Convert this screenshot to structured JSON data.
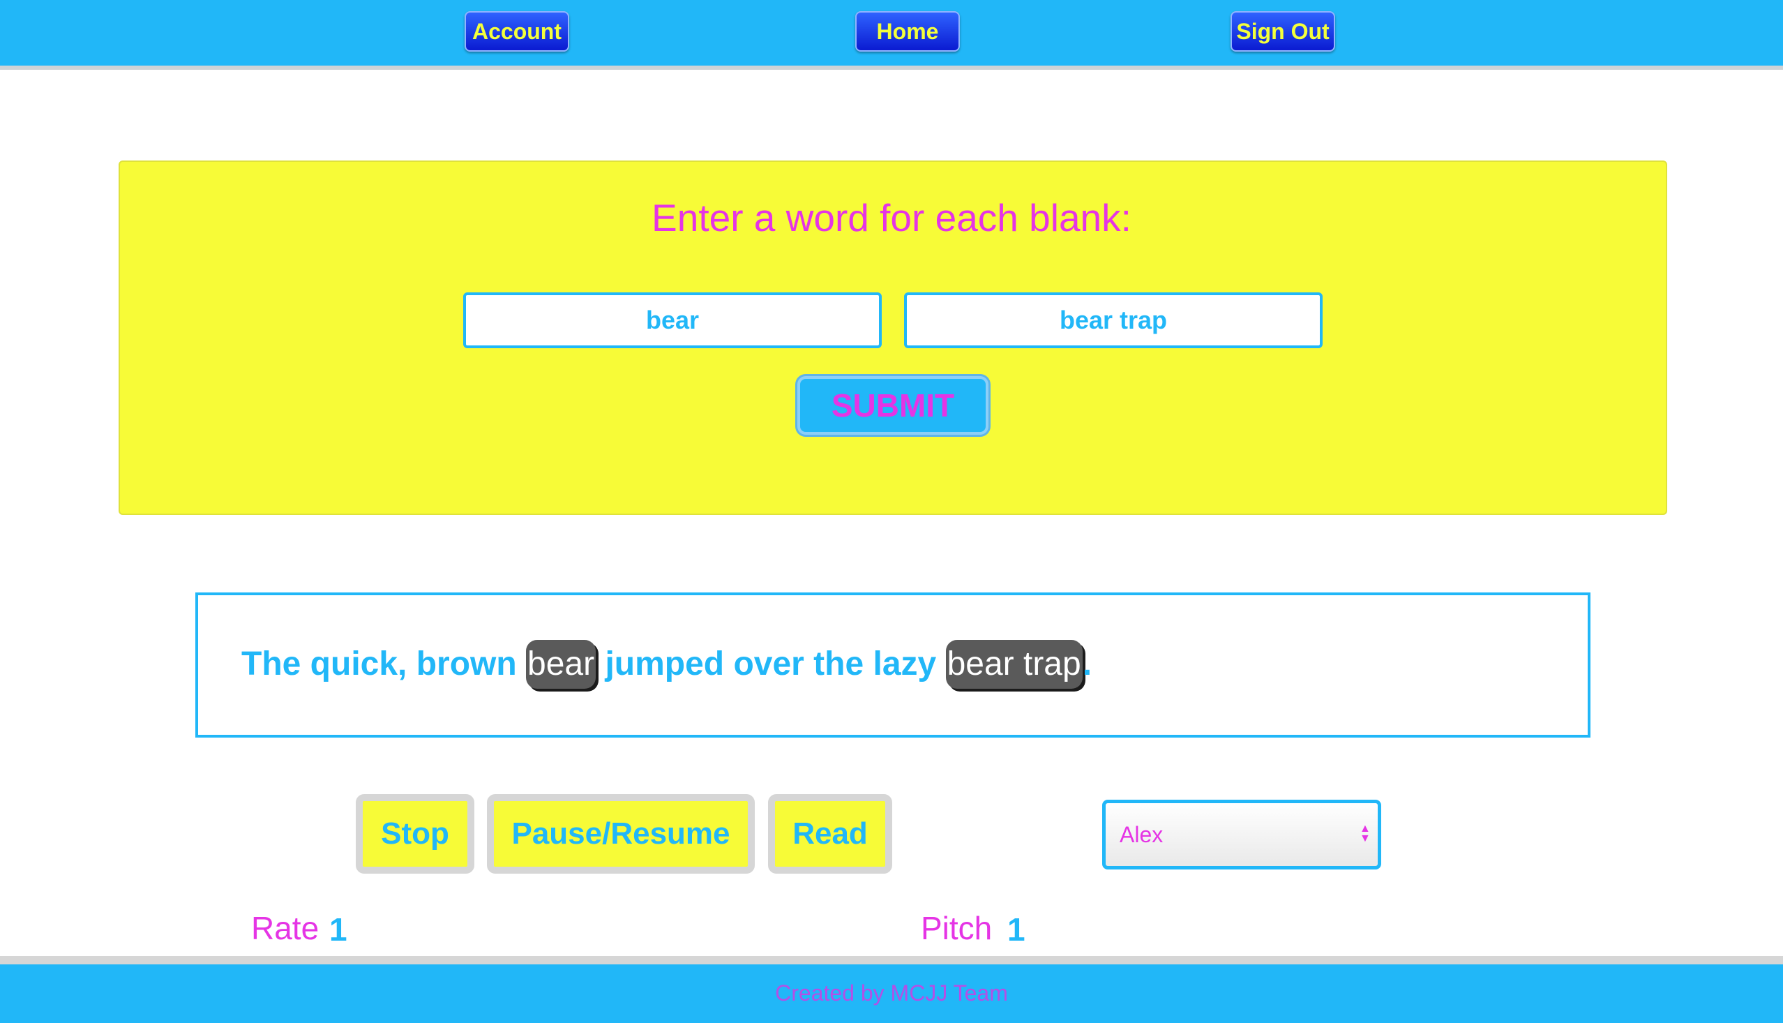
{
  "nav": {
    "account_label": "Account",
    "home_label": "Home",
    "signout_label": "Sign Out"
  },
  "form": {
    "title": "Enter a word for each blank:",
    "inputs": [
      "bear",
      "bear trap"
    ],
    "submit_label": "SUBMIT"
  },
  "story": {
    "segments": [
      "The quick, brown ",
      "bear",
      " jumped over the lazy ",
      "bear trap",
      "."
    ]
  },
  "controls": {
    "stop_label": "Stop",
    "pause_label": "Pause/Resume",
    "read_label": "Read",
    "voice_selected": "Alex"
  },
  "params": {
    "rate_label": "Rate",
    "rate_value": "1",
    "pitch_label": "Pitch",
    "pitch_value": "1"
  },
  "footer": {
    "text": "Created by MCJJ Team"
  },
  "colors": {
    "nav_bg": "#21b7f8",
    "card_bg": "#f7fb37",
    "accent_magenta": "#e534e5",
    "accent_blue": "#21b7f8",
    "nav_button": "#0b1bd1",
    "blank_fill": "#5a5a5a"
  },
  "icons": {
    "select_arrows": "updown-arrows-icon"
  }
}
